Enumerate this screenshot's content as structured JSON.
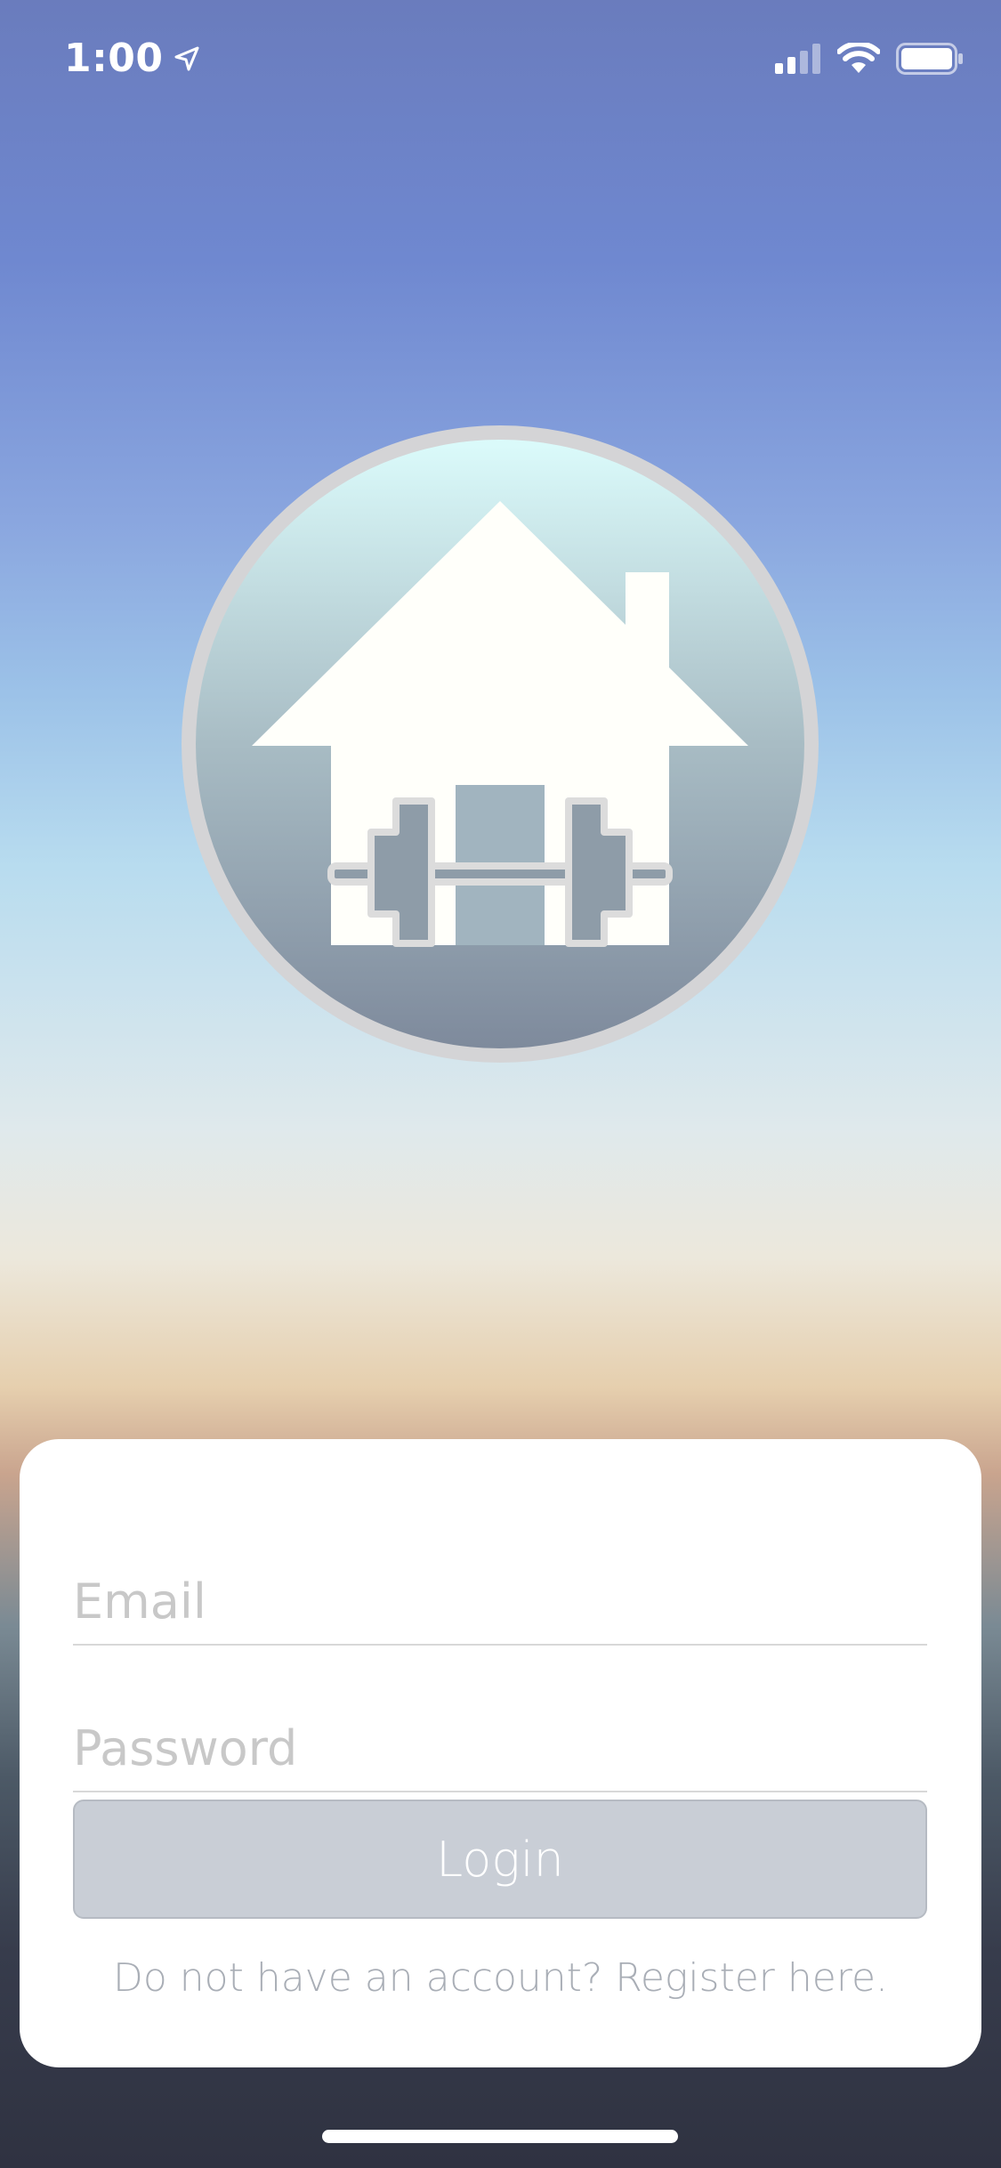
{
  "status_bar": {
    "time": "1:00",
    "location_icon": "location-arrow-icon",
    "signal_icon": "cellular-signal-icon",
    "wifi_icon": "wifi-icon",
    "battery_icon": "battery-icon"
  },
  "logo": {
    "icon": "house-dumbbell-logo-icon",
    "colors": {
      "ring": "#d4d4d6",
      "top": "#dbfbfb",
      "bottom": "#7e8a9c",
      "house": "#fffffa"
    }
  },
  "login_form": {
    "email_placeholder": "Email",
    "password_placeholder": "Password",
    "login_label": "Login",
    "register_text": "Do not have an account? Register here."
  },
  "colors": {
    "button_bg": "#c9ced6",
    "card_bg": "#ffffff",
    "muted_text": "#a9aeb6"
  }
}
